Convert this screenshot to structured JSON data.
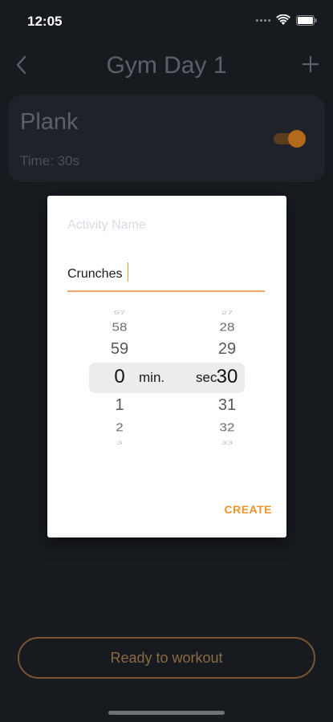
{
  "status_bar": {
    "time": "12:05"
  },
  "nav": {
    "title": "Gym Day 1"
  },
  "card": {
    "title": "Plank",
    "subtitle": "Time: 30s",
    "toggle_on": true
  },
  "dialog": {
    "label": "Activity Name",
    "input_value": "Crunches",
    "picker": {
      "minutes": [
        "57",
        "58",
        "59",
        "0",
        "1",
        "2",
        "3"
      ],
      "seconds": [
        "27",
        "28",
        "29",
        "30",
        "31",
        "32",
        "33"
      ],
      "min_unit": "min.",
      "sec_unit": "sec."
    },
    "create_label": "CREATE"
  },
  "bottom": {
    "ready_label": "Ready to workout"
  },
  "colors": {
    "accent": "#f0932b",
    "background": "#171a1f",
    "card": "#1f2228"
  }
}
